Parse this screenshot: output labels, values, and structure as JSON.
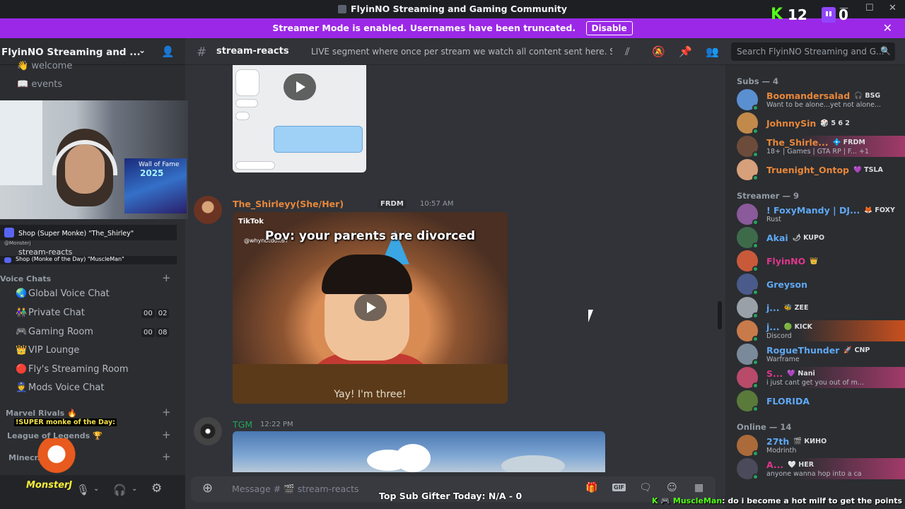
{
  "window": {
    "title": "FlyinNO Streaming and Gaming Community",
    "controls": [
      "—",
      "☐",
      "✕"
    ]
  },
  "overlay": {
    "kick_count": "12",
    "twitch_count": "0"
  },
  "streamer_banner": {
    "text": "Streamer Mode is enabled. Usernames have been truncated.",
    "disable_label": "Disable",
    "close": "✕"
  },
  "server": {
    "name": "FlyinNO Streaming and ...",
    "chevron": "⌄"
  },
  "sidebar": {
    "top_channels": [
      {
        "label": "👋 welcome"
      },
      {
        "label": "📖 events"
      }
    ],
    "shop_items": [
      "Shop (Super Monke) \"The_Shirley\"",
      "Shop (Monke of the Day) \"MuscleMan\""
    ],
    "shop_small": "@Monsterj",
    "active_channel": "stream-reacts",
    "voice_category": "Voice Chats",
    "voice_channels": [
      {
        "icon": "🌏",
        "label": "Global Voice Chat",
        "counts": []
      },
      {
        "icon": "👫",
        "label": "Private Chat",
        "counts": [
          "00",
          "02"
        ]
      },
      {
        "icon": "🎮",
        "label": "Gaming Room",
        "counts": [
          "00",
          "08"
        ]
      },
      {
        "icon": "👑",
        "label": "VIP Lounge",
        "counts": []
      },
      {
        "icon": "🔴",
        "label": "Fly's Streaming Room",
        "counts": []
      },
      {
        "icon": "👮",
        "label": "Mods Voice Chat",
        "counts": []
      }
    ],
    "categories": [
      {
        "label": "Marvel Rivals 🔥"
      },
      {
        "label": "League of Legends 🏆"
      },
      {
        "label": "Minecr..."
      }
    ],
    "monke_tag": "!SUPER monke of the Day:",
    "monster_name": "MonsterJ"
  },
  "webcam": {
    "poster_line1": "Wall of Fame",
    "poster_line2": "2025"
  },
  "channel_header": {
    "name": "stream-reacts",
    "topic": "LIVE segment where once per stream we watch all content sent here. Se...",
    "search_placeholder": "Search FlyinNO Streaming and G..."
  },
  "messages": [
    {
      "author": "The_Shirleyy(She/Her)",
      "badge": "FRDM",
      "time": "10:57 AM",
      "video_caption": "Pov: your parents are divorced",
      "video_tiktok": "TikTok",
      "video_handle": "@whynotdoit67",
      "video_subtitle": "Yay! I'm three!"
    },
    {
      "author": "TGM",
      "time": "12:22 PM"
    }
  ],
  "input": {
    "placeholder": "Message # 🎬 stream-reacts"
  },
  "top_sub": "Top Sub Gifter Today: N/A - 0",
  "members": {
    "sections": [
      {
        "title": "Subs — 4",
        "items": [
          {
            "name": "Boomandersalad",
            "tag": "🎧 BSG",
            "activity": "Want to be alone...yet not alone...",
            "color": "#e8873a"
          },
          {
            "name": "JohnnySin",
            "tag": "🎲 5 6 2",
            "activity": "",
            "color": "#e8873a"
          },
          {
            "name": "The_Shirle...",
            "tag": "💠 FRDM",
            "activity": "18+ | Games | GTA RP | F... +1",
            "color": "#e8873a"
          },
          {
            "name": "Truenight_Ontop",
            "tag": "💜 TSLA",
            "activity": "",
            "color": "#e8873a"
          }
        ]
      },
      {
        "title": "Streamer — 9",
        "items": [
          {
            "name": "! FoxyMandy | DJ...",
            "tag": "🦊 FOXY",
            "activity": "Rust",
            "color": "#5fa8f5"
          },
          {
            "name": "Akai",
            "tag": "🌶 KUPO",
            "activity": "",
            "color": "#5fa8f5"
          },
          {
            "name": "FlyinNO",
            "tag": "👑",
            "activity": "",
            "color": "#e0368c"
          },
          {
            "name": "Greyson",
            "tag": "",
            "activity": "",
            "color": "#5fa8f5"
          },
          {
            "name": "j...",
            "tag": "🐝 ZEE",
            "activity": "",
            "color": "#5fa8f5"
          },
          {
            "name": "j...",
            "tag": "🟢 KICK",
            "activity": "Discord",
            "color": "#5fa8f5"
          },
          {
            "name": "RogueThunder",
            "tag": "🚀 CNP",
            "activity": "Warframe",
            "color": "#5fa8f5"
          },
          {
            "name": "S...",
            "tag": "💜 Nani",
            "activity": "i just cant get you out of m...",
            "color": "#e0368c"
          },
          {
            "name": "FLORIDA",
            "tag": "",
            "activity": "",
            "color": "#5fa8f5"
          }
        ]
      },
      {
        "title": "Online — 14",
        "items": [
          {
            "name": "27th",
            "tag": "🎬 КИНО",
            "activity": "Modrinth",
            "color": "#5fa8f5"
          },
          {
            "name": "A...",
            "tag": "🤍 HER",
            "activity": "anyone wanna hop into a ca",
            "color": "#e0368c"
          }
        ]
      }
    ]
  },
  "overlay_chat": {
    "user": "MuscleMan",
    "message": ": do i become a hot milf to get the points"
  },
  "colors": {
    "streamer_banner": "#9b28e6",
    "kick_green": "#53fc18",
    "twitch_purple": "#9146ff",
    "sub_orange": "#e8873a",
    "streamer_blue": "#5fa8f5"
  }
}
